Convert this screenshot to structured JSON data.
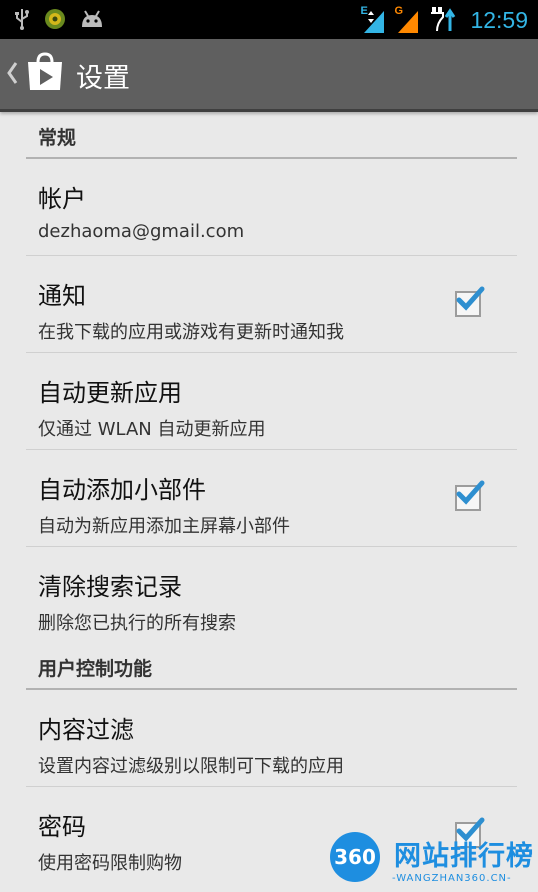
{
  "status_bar": {
    "time": "12:59",
    "left_icons": [
      "usb-icon",
      "app-notification-icon",
      "android-debug-icon"
    ],
    "network_1": "E",
    "network_2": "G"
  },
  "action_bar": {
    "title": "设置",
    "app_icon": "play-store-icon"
  },
  "sections": {
    "general": {
      "header": "常规",
      "account": {
        "title": "帐户",
        "summary": "dezhaoma@gmail.com"
      },
      "notifications": {
        "title": "通知",
        "summary": "在我下载的应用或游戏有更新时通知我",
        "checked": true
      },
      "auto_update": {
        "title": "自动更新应用",
        "summary": "仅通过 WLAN 自动更新应用"
      },
      "auto_widget": {
        "title": "自动添加小部件",
        "summary": "自动为新应用添加主屏幕小部件",
        "checked": true
      },
      "clear_history": {
        "title": "清除搜索记录",
        "summary": "删除您已执行的所有搜索"
      }
    },
    "user_controls": {
      "header": "用户控制功能",
      "content_filter": {
        "title": "内容过滤",
        "summary": "设置内容过滤级别以限制可下载的应用"
      },
      "password": {
        "title": "密码",
        "summary": "使用密码限制购物",
        "checked": true
      }
    }
  },
  "watermark": {
    "badge": "360",
    "name": "网站排行榜",
    "url": "-WANGZHAN360.CN-"
  },
  "colors": {
    "accent": "#33b5e5",
    "action_bar": "#5f5f5f",
    "background": "#e9e9e9"
  }
}
